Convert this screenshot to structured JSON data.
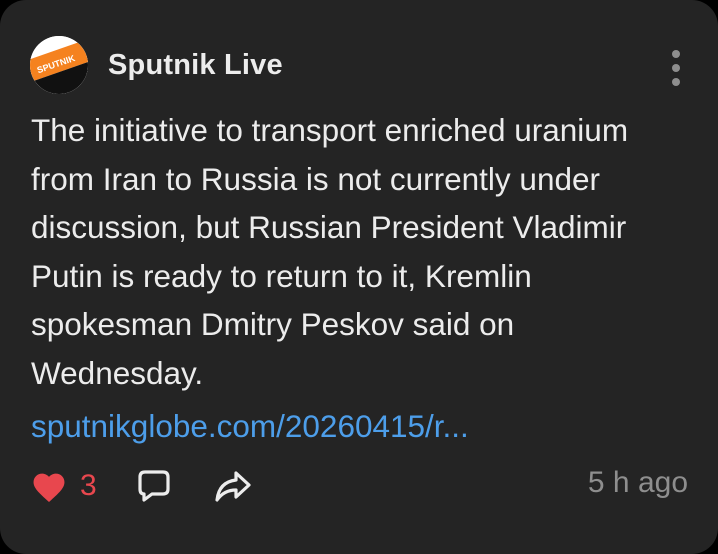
{
  "post": {
    "channel_name": "Sputnik Live",
    "avatar_icon": "sputnik-logo",
    "message": "The initiative to transport enriched uranium from Iran to Russia is not currently under discussion, but Russian President Vladimir Putin is ready to return to it, Kremlin spokesman Dmitry Peskov said on Wednesday.",
    "link_text": "sputnikglobe.com/20260415/r...",
    "likes_count": "3",
    "timestamp": "5 h ago"
  },
  "icons": {
    "more": "vertical-dots-icon",
    "like": "heart-icon",
    "comment": "speech-bubble-icon",
    "share": "share-arrow-icon"
  },
  "colors": {
    "background": "#000000",
    "card": "#242424",
    "text": "#ececec",
    "link": "#4d9eea",
    "like": "#e8474e",
    "muted": "#8e8e8e",
    "brand": "#f5821f"
  }
}
